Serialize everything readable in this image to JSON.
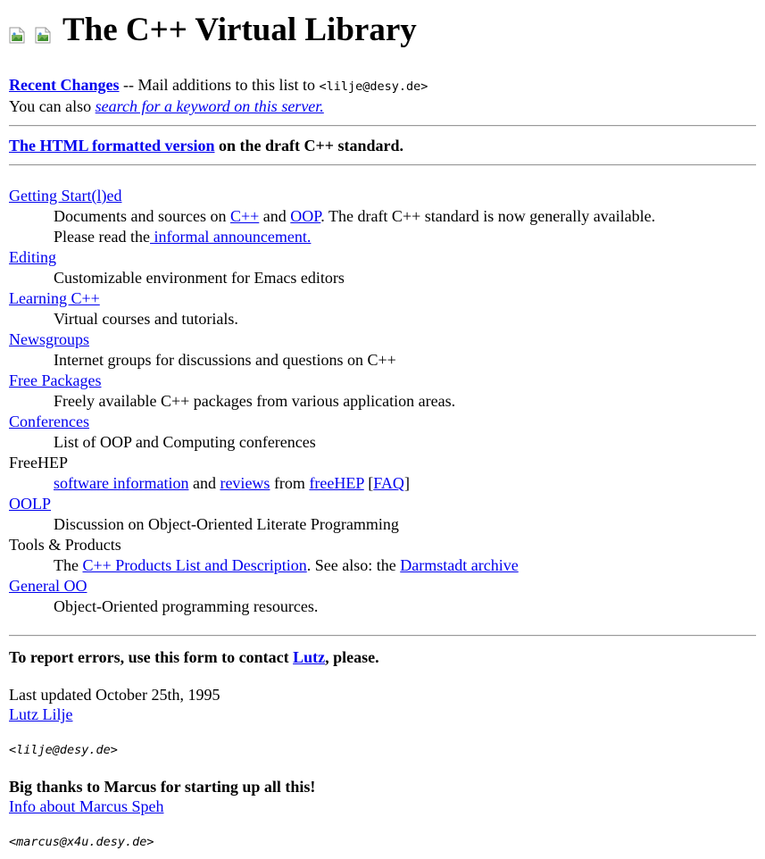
{
  "header": {
    "title": "The C++ Virtual Library"
  },
  "intro": {
    "recent_changes": "Recent Changes",
    "mail_text": " -- Mail additions to this list to ",
    "mail_addr": "<lilje@desy.de>",
    "also_text": "You can also ",
    "search_link": "search for a keyword on this server."
  },
  "draft": {
    "link": "The HTML formatted version",
    "text": " on the draft C++ standard."
  },
  "entries": {
    "getting_started": {
      "term": "Getting Start(l)ed",
      "pre": "Documents and sources on ",
      "cpp": "C++",
      "and": " and ",
      "oop": "OOP",
      "post": ". The draft C++ standard is now generally available.",
      "read": "Please read the",
      "announce": " informal announcement."
    },
    "editing": {
      "term": "Editing",
      "desc": "Customizable environment for Emacs editors"
    },
    "learning": {
      "term": "Learning C++",
      "desc": "Virtual courses and tutorials."
    },
    "newsgroups": {
      "term": "Newsgroups",
      "desc": "Internet groups for discussions and questions on C++"
    },
    "free_packages": {
      "term": "Free Packages",
      "desc": "Freely available C++ packages from various application areas."
    },
    "conferences": {
      "term": "Conferences",
      "desc": "List of OOP and Computing conferences"
    },
    "freehep": {
      "term": "FreeHEP",
      "software": "software information",
      "and": " and ",
      "reviews": "reviews",
      "from": " from ",
      "freehep_link": "freeHEP",
      "open": " [",
      "faq": "FAQ",
      "close": "]"
    },
    "oolp": {
      "term": "OOLP",
      "desc": "Discussion on Object-Oriented Literate Programming"
    },
    "tools": {
      "term": "Tools & Products",
      "the": "The ",
      "products_link": "C++ Products List and Description",
      "see_also": ". See also: the ",
      "darmstadt": "Darmstadt archive"
    },
    "general_oo": {
      "term": "General OO",
      "desc": "Object-Oriented programming resources."
    }
  },
  "footer": {
    "report_pre": "To report errors, use this form to contact ",
    "report_link": "Lutz",
    "report_post": ", please.",
    "updated": "Last updated October 25th, 1995",
    "author_link": "Lutz Lilje",
    "author_addr": "<lilje@desy.de>",
    "thanks": "Big thanks to Marcus for starting up all this!",
    "marcus_link": "Info about Marcus Speh",
    "marcus_addr": "<marcus@x4u.desy.de>"
  }
}
